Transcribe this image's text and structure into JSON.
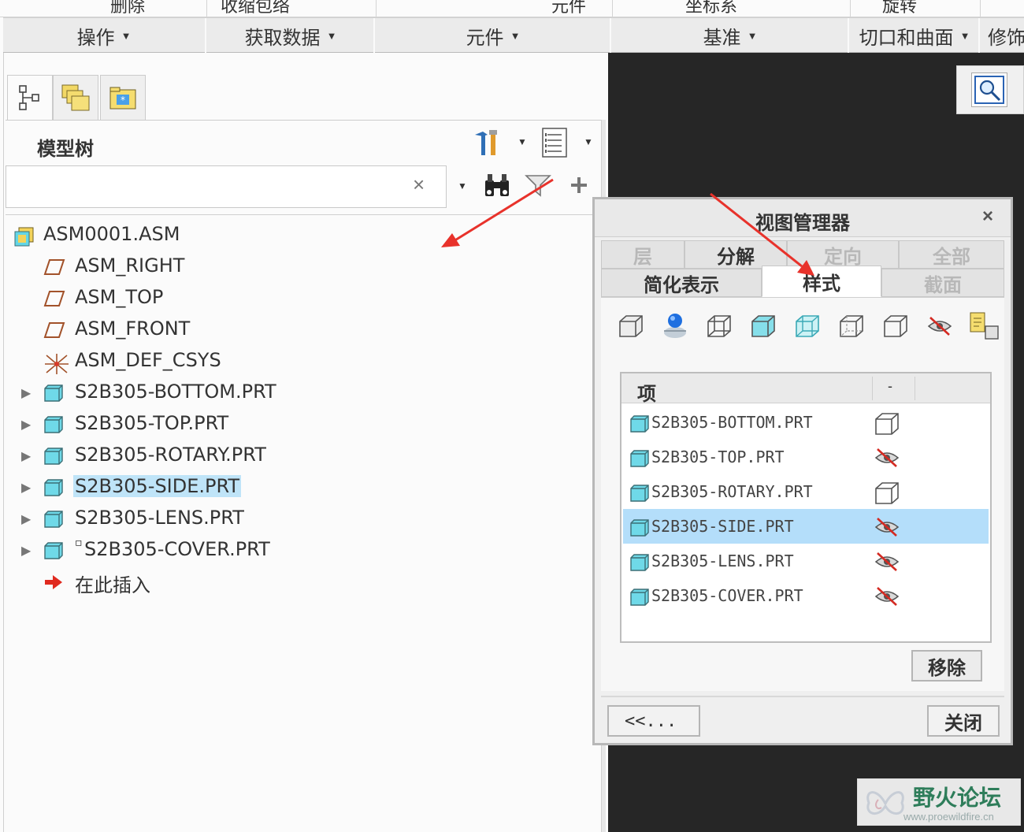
{
  "ribbon": {
    "top_items": [
      "删除",
      "收缩包络",
      "元件",
      "坐标系",
      "旋转"
    ],
    "groups": [
      {
        "label": "操作"
      },
      {
        "label": "获取数据"
      },
      {
        "label": "元件"
      },
      {
        "label": "基准"
      },
      {
        "label": "切口和曲面"
      },
      {
        "label": "修饰"
      }
    ]
  },
  "model_tree": {
    "title": "模型树",
    "search": {
      "value": "",
      "placeholder": "",
      "clear": "×"
    },
    "items": [
      {
        "label": "ASM0001.ASM",
        "icon": "assembly-icon",
        "expandable": false,
        "selected": false
      },
      {
        "label": "ASM_RIGHT",
        "icon": "datum-plane-icon",
        "expandable": false,
        "selected": false
      },
      {
        "label": "ASM_TOP",
        "icon": "datum-plane-icon",
        "expandable": false,
        "selected": false
      },
      {
        "label": "ASM_FRONT",
        "icon": "datum-plane-icon",
        "expandable": false,
        "selected": false
      },
      {
        "label": "ASM_DEF_CSYS",
        "icon": "csys-icon",
        "expandable": false,
        "selected": false
      },
      {
        "label": "S2B305-BOTTOM.PRT",
        "icon": "part-icon",
        "expandable": true,
        "selected": false
      },
      {
        "label": "S2B305-TOP.PRT",
        "icon": "part-icon",
        "expandable": true,
        "selected": false
      },
      {
        "label": "S2B305-ROTARY.PRT",
        "icon": "part-icon",
        "expandable": true,
        "selected": false
      },
      {
        "label": "S2B305-SIDE.PRT",
        "icon": "part-icon",
        "expandable": true,
        "selected": true
      },
      {
        "label": "S2B305-LENS.PRT",
        "icon": "part-icon",
        "expandable": true,
        "selected": false
      },
      {
        "label": "S2B305-COVER.PRT",
        "icon": "part-icon",
        "expandable": true,
        "selected": false,
        "marker": "▫"
      },
      {
        "label": "在此插入",
        "icon": "insert-arrow-icon",
        "expandable": false,
        "selected": false
      }
    ]
  },
  "view_manager": {
    "title": "视图管理器",
    "close_glyph": "×",
    "tabs_row1": [
      {
        "label": "层",
        "state": "disabled"
      },
      {
        "label": "分解",
        "state": "normal"
      },
      {
        "label": "定向",
        "state": "disabled"
      },
      {
        "label": "全部",
        "state": "disabled"
      }
    ],
    "tabs_row2": [
      {
        "label": "简化表示",
        "state": "normal"
      },
      {
        "label": "样式",
        "state": "active"
      },
      {
        "label": "截面",
        "state": "disabled"
      }
    ],
    "style_buttons": [
      "shaded-box-icon",
      "blue-sphere-icon",
      "wireframe-box-icon",
      "cyan-shaded-box-icon",
      "transparent-box-icon",
      "hidden-line-box-icon",
      "no-hidden-box-icon",
      "blank-eye-icon",
      "copy-style-icon"
    ],
    "table": {
      "col_item": "项",
      "col_style": "-",
      "rows": [
        {
          "name": "S2B305-BOTTOM.PRT",
          "style": "wireframe",
          "selected": false
        },
        {
          "name": "S2B305-TOP.PRT",
          "style": "blank",
          "selected": false
        },
        {
          "name": "S2B305-ROTARY.PRT",
          "style": "wireframe",
          "selected": false
        },
        {
          "name": "S2B305-SIDE.PRT",
          "style": "blank",
          "selected": true
        },
        {
          "name": "S2B305-LENS.PRT",
          "style": "blank",
          "selected": false
        },
        {
          "name": "S2B305-COVER.PRT",
          "style": "blank",
          "selected": false
        }
      ]
    },
    "remove_label": "移除",
    "back_label": "<<...",
    "close_label": "关闭"
  },
  "watermark": {
    "name": "野火论坛",
    "url": "www.proewildfire.cn"
  },
  "colors": {
    "selection": "#bfe4f8",
    "graphics_bg": "#262626",
    "part_cyan": "#63d6e6",
    "annotation_red": "#e8322b"
  }
}
